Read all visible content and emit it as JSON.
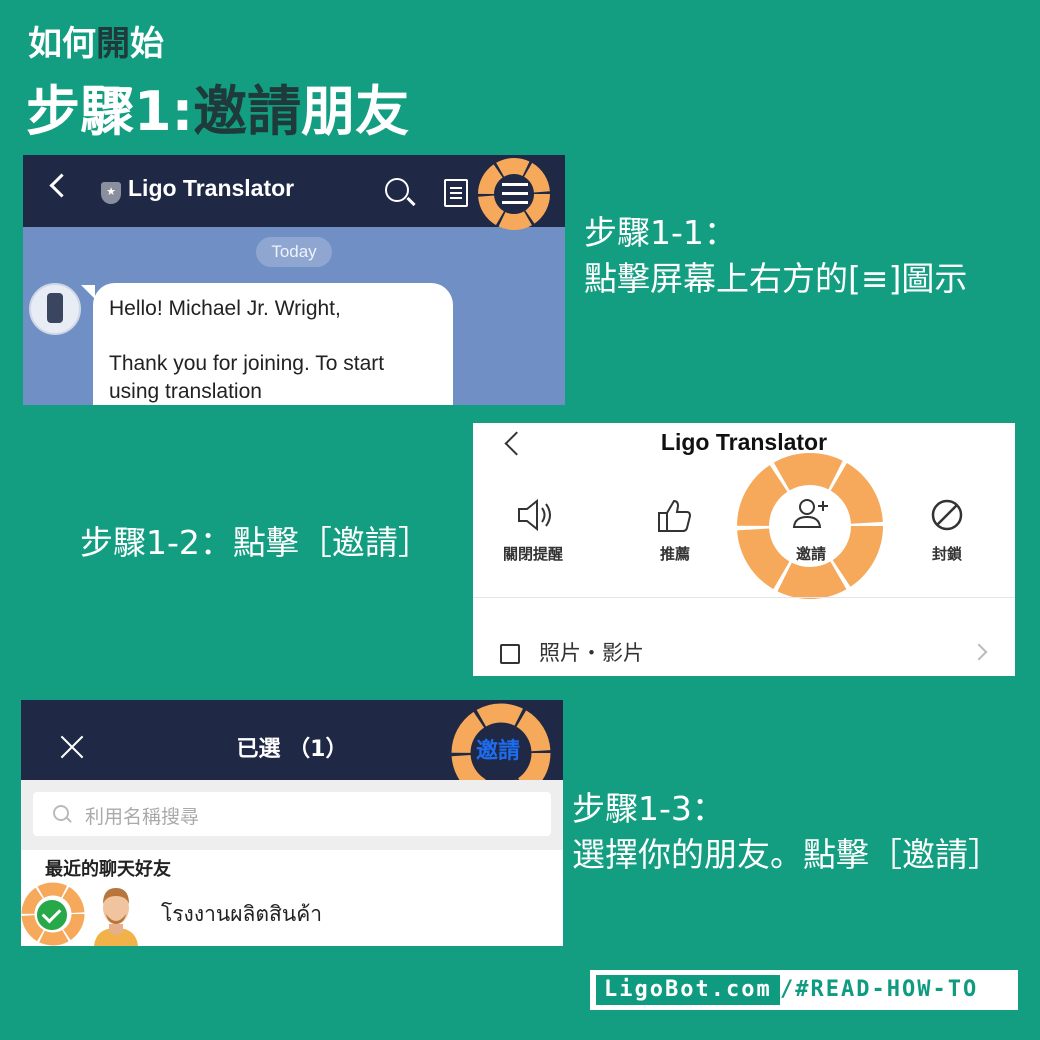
{
  "heading": {
    "small_prefix": "如何",
    "small_accent": "開",
    "small_suffix": "始",
    "big_prefix": "步驟",
    "big_num": "1:",
    "big_accent": "邀請",
    "big_suffix": "朋友"
  },
  "colors": {
    "background": "#139e82",
    "navbar": "#1f2844",
    "highlight": "#f6a95a",
    "accent_text": "#1e3a3a",
    "invite_blue": "#1e6df0"
  },
  "step1_1": {
    "line1": "步驟1-1：",
    "line2": "點擊屏幕上右方的[≡]圖示"
  },
  "step1_2": {
    "text": "步驟1-2：點擊［邀請］"
  },
  "step1_3": {
    "line1": "步驟1-3：",
    "line2": "選擇你的朋友。點擊［邀請］"
  },
  "panel1": {
    "app_title": "Ligo Translator",
    "date_chip": "Today",
    "message_line1": "Hello! Michael Jr. Wright,",
    "message_line2": "Thank you for joining. To start using translation",
    "icons": [
      "back-icon",
      "shield-icon",
      "search-icon",
      "note-icon",
      "menu-icon"
    ]
  },
  "panel2": {
    "app_title": "Ligo Translator",
    "actions": [
      {
        "label": "關閉提醒",
        "icon": "speaker-icon"
      },
      {
        "label": "推薦",
        "icon": "thumbs-up-icon"
      },
      {
        "label": "邀請",
        "icon": "add-user-icon"
      },
      {
        "label": "封鎖",
        "icon": "block-icon"
      }
    ],
    "photos_label": "照片・影片"
  },
  "panel3": {
    "selected_title": "已選 （1）",
    "invite_button": "邀請",
    "search_placeholder": "利用名稱搜尋",
    "section_title": "最近的聊天好友",
    "friend_name": "โรงงานผลิตสินค้า"
  },
  "footer": {
    "site": "LigoBot.com",
    "tag": "/#READ-HOW-TO"
  }
}
